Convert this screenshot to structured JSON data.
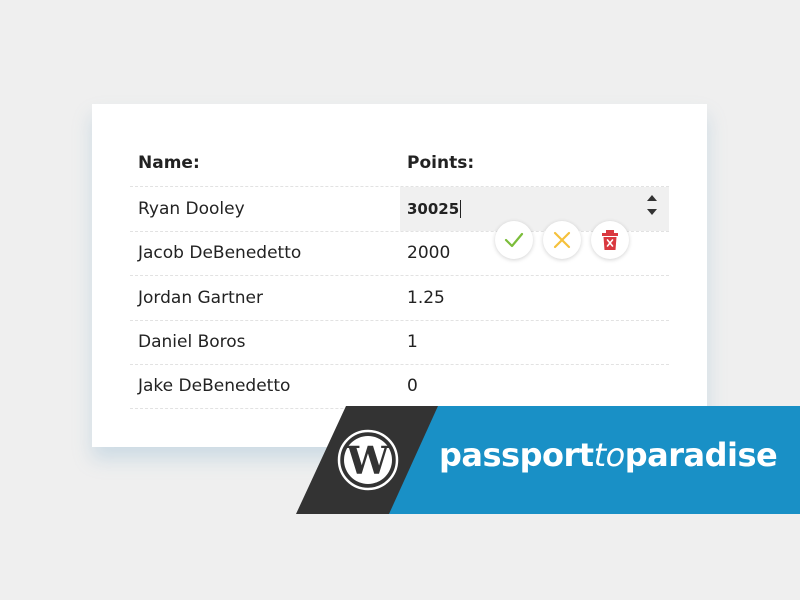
{
  "table": {
    "headers": {
      "name": "Name:",
      "points": "Points:"
    },
    "rows": [
      {
        "name": "Ryan Dooley",
        "points": "30025"
      },
      {
        "name": "Jacob DeBenedetto",
        "points": "2000"
      },
      {
        "name": "Jordan Gartner",
        "points": "1.25"
      },
      {
        "name": "Daniel Boros",
        "points": "1"
      },
      {
        "name": "Jake DeBenedetto",
        "points": "0"
      }
    ]
  },
  "actions": {
    "confirm_icon": "check-icon",
    "cancel_icon": "close-icon",
    "delete_icon": "trash-icon"
  },
  "banner": {
    "logo": "wordpress-logo",
    "brand_part1": "passport",
    "brand_part2": "to",
    "brand_part3": "paradise"
  },
  "colors": {
    "confirm": "#7cbd3b",
    "cancel": "#f5c13c",
    "delete": "#d9383f",
    "banner_blue": "#1990c6",
    "banner_dark": "#333333"
  }
}
